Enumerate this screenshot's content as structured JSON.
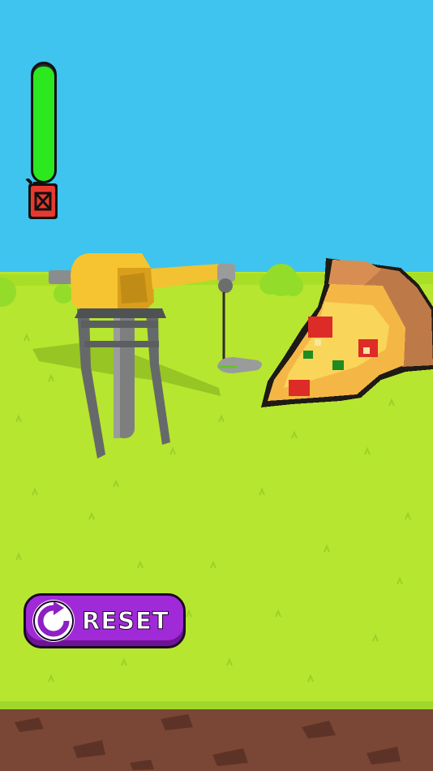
{
  "hud": {
    "fuel": {
      "level": 0.98,
      "icon": "fuel-can-icon",
      "fill_color": "#2be81f",
      "can_color": "#e8392f"
    },
    "reset_button": {
      "label": "RESET",
      "icon": "reset-arrow-icon",
      "color": "#a12ad8"
    }
  },
  "scene": {
    "sky_color": "#3ec4ee",
    "grass_color": "#b6e62f",
    "dirt_color": "#7a4636",
    "crane_color": "#f5c430",
    "subject": "pixel-pizza-slice"
  }
}
